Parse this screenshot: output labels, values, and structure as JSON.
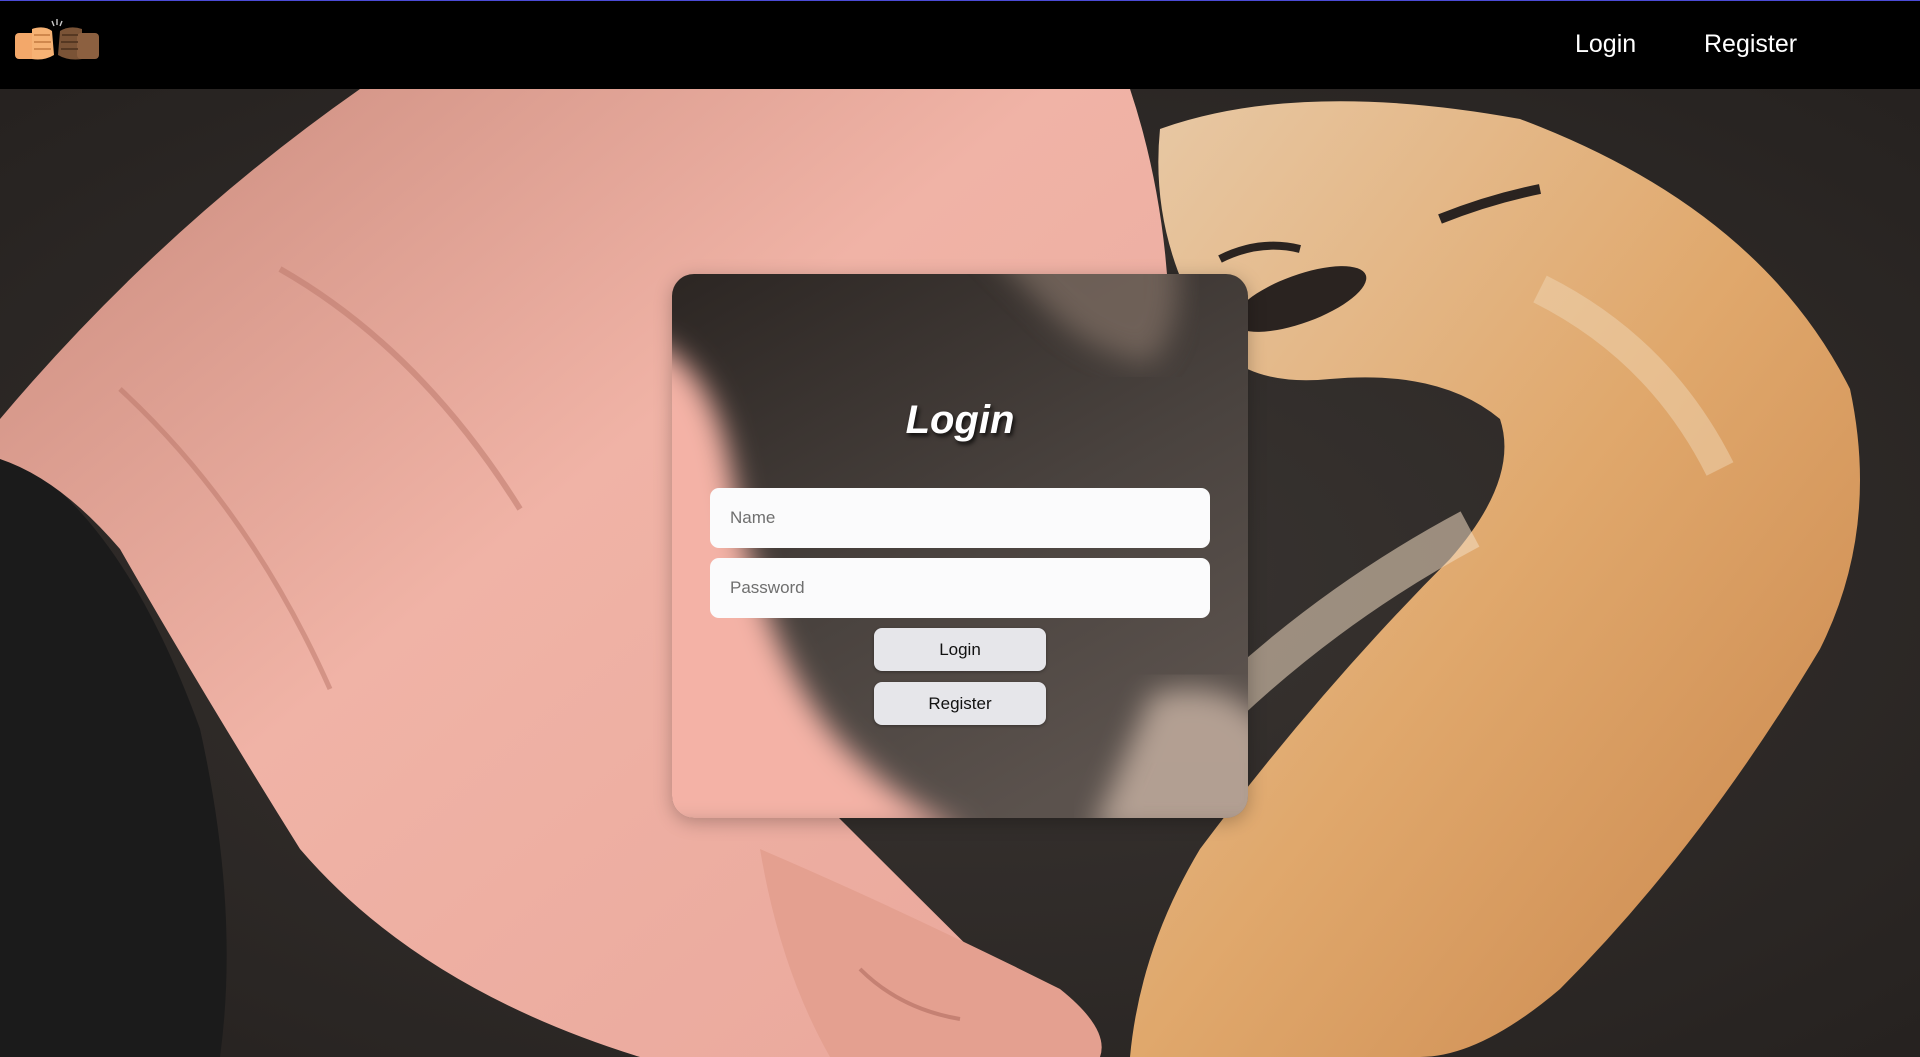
{
  "navbar": {
    "logo_icon": "fist-bump-logo-icon",
    "links": [
      {
        "label": "Login"
      },
      {
        "label": "Register"
      }
    ]
  },
  "background": {
    "icon": "hand-and-paw-heart-photo"
  },
  "login_card": {
    "title": "Login",
    "name_placeholder": "Name",
    "password_placeholder": "Password",
    "login_button": "Login",
    "register_button": "Register"
  },
  "colors": {
    "navbar_bg": "#000000",
    "nav_text": "#ffffff",
    "button_bg": "#e6e6ea",
    "input_bg": "#fbfbfc"
  }
}
